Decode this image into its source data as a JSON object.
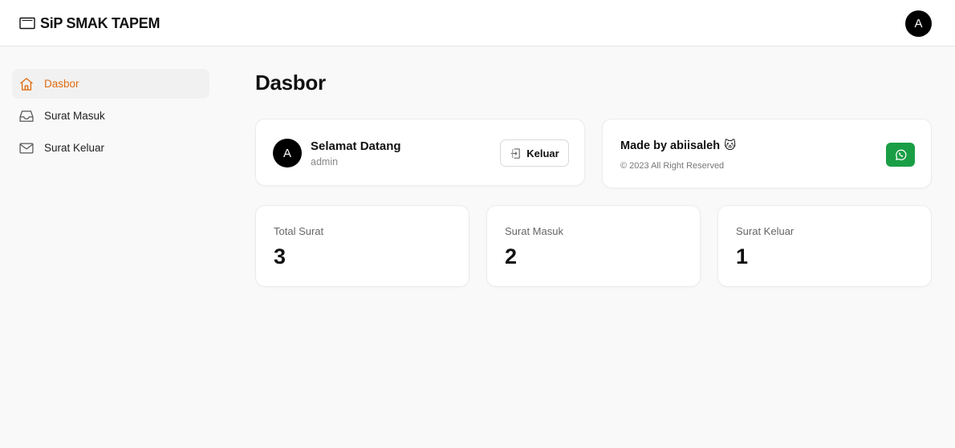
{
  "header": {
    "brand_title": "SiP SMAK TAPEM",
    "brand_icon": "envelope-icon",
    "user_avatar_initial": "A"
  },
  "sidebar": {
    "items": [
      {
        "label": "Dasbor",
        "icon": "home-icon",
        "active": true
      },
      {
        "label": "Surat Masuk",
        "icon": "inbox-icon",
        "active": false
      },
      {
        "label": "Surat Keluar",
        "icon": "mail-icon",
        "active": false
      }
    ]
  },
  "main": {
    "page_title": "Dasbor",
    "welcome": {
      "avatar_initial": "A",
      "greeting": "Selamat Datang",
      "role": "admin",
      "logout_label": "Keluar"
    },
    "credit": {
      "made_by": "Made by abiisaleh",
      "emoji": "🐱",
      "copyright": "© 2023 All Right Reserved",
      "button_icon": "whatsapp-icon"
    },
    "stats": [
      {
        "label": "Total Surat",
        "value": "3"
      },
      {
        "label": "Surat Masuk",
        "value": "2"
      },
      {
        "label": "Surat Keluar",
        "value": "1"
      }
    ]
  },
  "colors": {
    "accent": "#e06c12",
    "whatsapp": "#1a9e45",
    "background": "#f9f9f9"
  }
}
